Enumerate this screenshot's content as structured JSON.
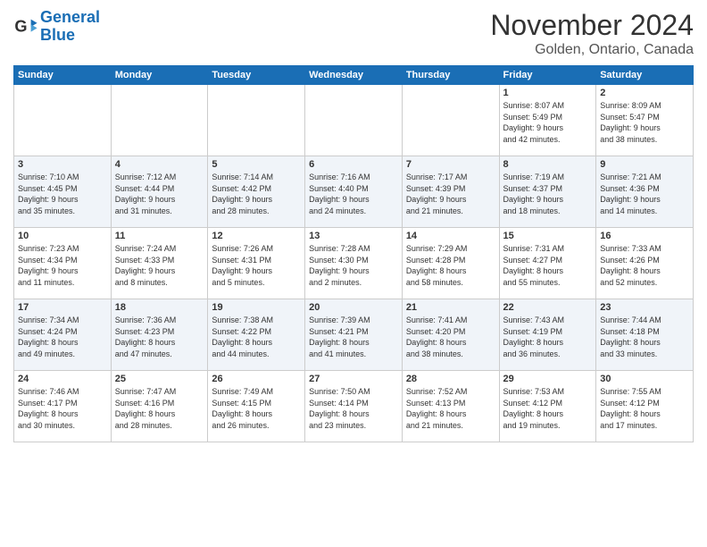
{
  "header": {
    "logo_line1": "General",
    "logo_line2": "Blue",
    "month": "November 2024",
    "location": "Golden, Ontario, Canada"
  },
  "days_of_week": [
    "Sunday",
    "Monday",
    "Tuesday",
    "Wednesday",
    "Thursday",
    "Friday",
    "Saturday"
  ],
  "weeks": [
    [
      {
        "day": "",
        "info": ""
      },
      {
        "day": "",
        "info": ""
      },
      {
        "day": "",
        "info": ""
      },
      {
        "day": "",
        "info": ""
      },
      {
        "day": "",
        "info": ""
      },
      {
        "day": "1",
        "info": "Sunrise: 8:07 AM\nSunset: 5:49 PM\nDaylight: 9 hours\nand 42 minutes."
      },
      {
        "day": "2",
        "info": "Sunrise: 8:09 AM\nSunset: 5:47 PM\nDaylight: 9 hours\nand 38 minutes."
      }
    ],
    [
      {
        "day": "3",
        "info": "Sunrise: 7:10 AM\nSunset: 4:45 PM\nDaylight: 9 hours\nand 35 minutes."
      },
      {
        "day": "4",
        "info": "Sunrise: 7:12 AM\nSunset: 4:44 PM\nDaylight: 9 hours\nand 31 minutes."
      },
      {
        "day": "5",
        "info": "Sunrise: 7:14 AM\nSunset: 4:42 PM\nDaylight: 9 hours\nand 28 minutes."
      },
      {
        "day": "6",
        "info": "Sunrise: 7:16 AM\nSunset: 4:40 PM\nDaylight: 9 hours\nand 24 minutes."
      },
      {
        "day": "7",
        "info": "Sunrise: 7:17 AM\nSunset: 4:39 PM\nDaylight: 9 hours\nand 21 minutes."
      },
      {
        "day": "8",
        "info": "Sunrise: 7:19 AM\nSunset: 4:37 PM\nDaylight: 9 hours\nand 18 minutes."
      },
      {
        "day": "9",
        "info": "Sunrise: 7:21 AM\nSunset: 4:36 PM\nDaylight: 9 hours\nand 14 minutes."
      }
    ],
    [
      {
        "day": "10",
        "info": "Sunrise: 7:23 AM\nSunset: 4:34 PM\nDaylight: 9 hours\nand 11 minutes."
      },
      {
        "day": "11",
        "info": "Sunrise: 7:24 AM\nSunset: 4:33 PM\nDaylight: 9 hours\nand 8 minutes."
      },
      {
        "day": "12",
        "info": "Sunrise: 7:26 AM\nSunset: 4:31 PM\nDaylight: 9 hours\nand 5 minutes."
      },
      {
        "day": "13",
        "info": "Sunrise: 7:28 AM\nSunset: 4:30 PM\nDaylight: 9 hours\nand 2 minutes."
      },
      {
        "day": "14",
        "info": "Sunrise: 7:29 AM\nSunset: 4:28 PM\nDaylight: 8 hours\nand 58 minutes."
      },
      {
        "day": "15",
        "info": "Sunrise: 7:31 AM\nSunset: 4:27 PM\nDaylight: 8 hours\nand 55 minutes."
      },
      {
        "day": "16",
        "info": "Sunrise: 7:33 AM\nSunset: 4:26 PM\nDaylight: 8 hours\nand 52 minutes."
      }
    ],
    [
      {
        "day": "17",
        "info": "Sunrise: 7:34 AM\nSunset: 4:24 PM\nDaylight: 8 hours\nand 49 minutes."
      },
      {
        "day": "18",
        "info": "Sunrise: 7:36 AM\nSunset: 4:23 PM\nDaylight: 8 hours\nand 47 minutes."
      },
      {
        "day": "19",
        "info": "Sunrise: 7:38 AM\nSunset: 4:22 PM\nDaylight: 8 hours\nand 44 minutes."
      },
      {
        "day": "20",
        "info": "Sunrise: 7:39 AM\nSunset: 4:21 PM\nDaylight: 8 hours\nand 41 minutes."
      },
      {
        "day": "21",
        "info": "Sunrise: 7:41 AM\nSunset: 4:20 PM\nDaylight: 8 hours\nand 38 minutes."
      },
      {
        "day": "22",
        "info": "Sunrise: 7:43 AM\nSunset: 4:19 PM\nDaylight: 8 hours\nand 36 minutes."
      },
      {
        "day": "23",
        "info": "Sunrise: 7:44 AM\nSunset: 4:18 PM\nDaylight: 8 hours\nand 33 minutes."
      }
    ],
    [
      {
        "day": "24",
        "info": "Sunrise: 7:46 AM\nSunset: 4:17 PM\nDaylight: 8 hours\nand 30 minutes."
      },
      {
        "day": "25",
        "info": "Sunrise: 7:47 AM\nSunset: 4:16 PM\nDaylight: 8 hours\nand 28 minutes."
      },
      {
        "day": "26",
        "info": "Sunrise: 7:49 AM\nSunset: 4:15 PM\nDaylight: 8 hours\nand 26 minutes."
      },
      {
        "day": "27",
        "info": "Sunrise: 7:50 AM\nSunset: 4:14 PM\nDaylight: 8 hours\nand 23 minutes."
      },
      {
        "day": "28",
        "info": "Sunrise: 7:52 AM\nSunset: 4:13 PM\nDaylight: 8 hours\nand 21 minutes."
      },
      {
        "day": "29",
        "info": "Sunrise: 7:53 AM\nSunset: 4:12 PM\nDaylight: 8 hours\nand 19 minutes."
      },
      {
        "day": "30",
        "info": "Sunrise: 7:55 AM\nSunset: 4:12 PM\nDaylight: 8 hours\nand 17 minutes."
      }
    ]
  ]
}
